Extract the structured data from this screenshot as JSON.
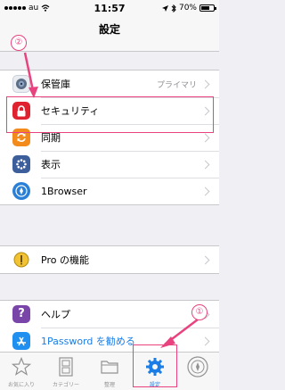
{
  "status_bar": {
    "carrier": "au",
    "time": "11:57",
    "battery": "70%",
    "battery_level": 0.7
  },
  "nav": {
    "title": "設定"
  },
  "section1": [
    {
      "label": "保管庫",
      "detail": "プライマリ",
      "icon": "vault-icon"
    },
    {
      "label": "セキュリティ",
      "detail": "",
      "icon": "lock-icon"
    },
    {
      "label": "同期",
      "detail": "",
      "icon": "sync-icon"
    },
    {
      "label": "表示",
      "detail": "",
      "icon": "display-icon"
    },
    {
      "label": "1Browser",
      "detail": "",
      "icon": "browser-icon"
    }
  ],
  "section2": [
    {
      "label": "Pro の機能",
      "icon": "pro-icon"
    }
  ],
  "section3": [
    {
      "label": "ヘルプ",
      "icon": "help-icon"
    },
    {
      "label": "1Password を勧める",
      "icon": "app-store-icon"
    }
  ],
  "tabs": [
    {
      "label": "お気に入り"
    },
    {
      "label": "カテゴリー"
    },
    {
      "label": "整理"
    },
    {
      "label": "設定"
    },
    {
      "label": ""
    }
  ],
  "annotations": {
    "step1": "①",
    "step2": "②"
  },
  "colors": {
    "accent": "#e8437f",
    "tab_active": "#1a7ee6",
    "security_red": "#e0212f"
  }
}
